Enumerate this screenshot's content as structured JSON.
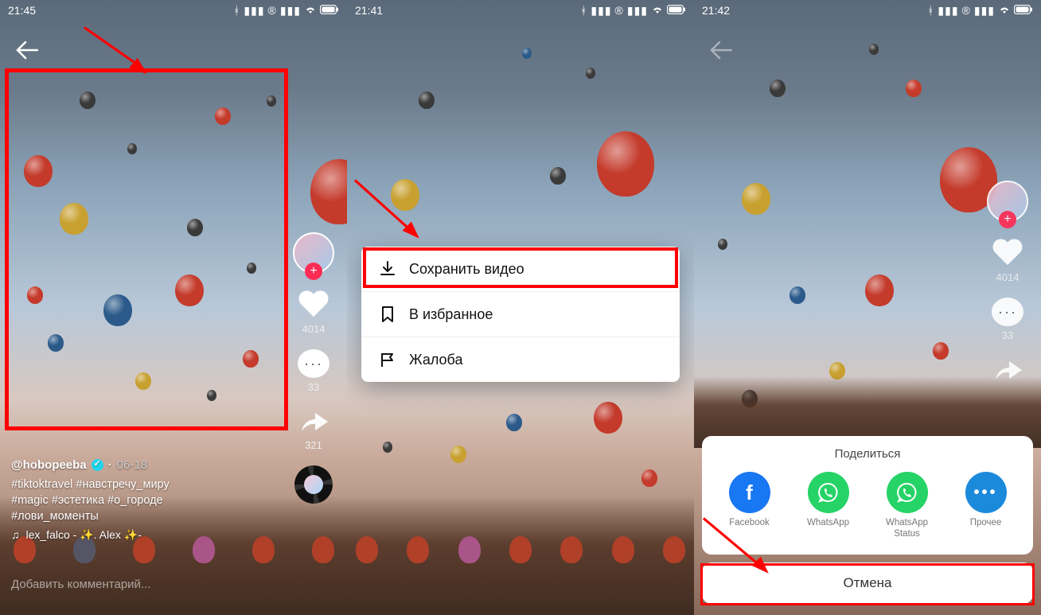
{
  "screens": [
    {
      "time": "21:45"
    },
    {
      "time": "21:41"
    },
    {
      "time": "21:42"
    }
  ],
  "video": {
    "username": "@hobopeeba",
    "date": "06-18",
    "hashtags_line1": "#tiktoktravel #навстречу_миру",
    "hashtags_line2": "#magic #эстетика #о_городе",
    "hashtags_line3": "#лови_моменты",
    "music": "lex_falco - ✨. Alex ✨-",
    "comment_placeholder": "Добавить комментарий..."
  },
  "rail": {
    "likes": "4014",
    "comments": "33",
    "shares": "321"
  },
  "context_menu": [
    {
      "icon": "download",
      "label": "Сохранить видео"
    },
    {
      "icon": "bookmark",
      "label": "В избранное"
    },
    {
      "icon": "flag",
      "label": "Жалоба"
    }
  ],
  "share_sheet": {
    "title": "Поделиться",
    "items": [
      {
        "key": "facebook",
        "label": "Facebook"
      },
      {
        "key": "whatsapp",
        "label": "WhatsApp"
      },
      {
        "key": "whatsapp-status",
        "label": "WhatsApp Status"
      },
      {
        "key": "more",
        "label": "Прочее"
      }
    ],
    "cancel": "Отмена"
  }
}
